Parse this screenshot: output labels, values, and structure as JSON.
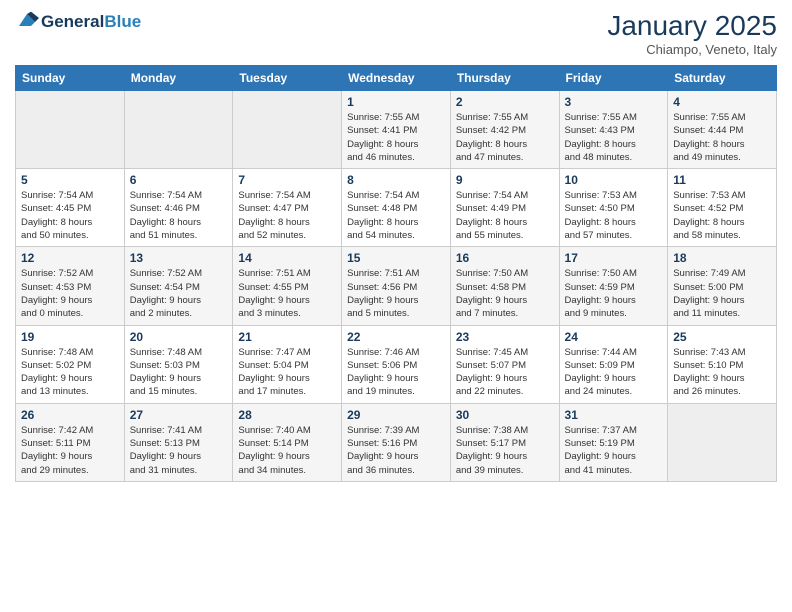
{
  "header": {
    "logo_line1": "General",
    "logo_line2": "Blue",
    "month": "January 2025",
    "location": "Chiampo, Veneto, Italy"
  },
  "weekdays": [
    "Sunday",
    "Monday",
    "Tuesday",
    "Wednesday",
    "Thursday",
    "Friday",
    "Saturday"
  ],
  "weeks": [
    [
      {
        "day": "",
        "info": ""
      },
      {
        "day": "",
        "info": ""
      },
      {
        "day": "",
        "info": ""
      },
      {
        "day": "1",
        "info": "Sunrise: 7:55 AM\nSunset: 4:41 PM\nDaylight: 8 hours\nand 46 minutes."
      },
      {
        "day": "2",
        "info": "Sunrise: 7:55 AM\nSunset: 4:42 PM\nDaylight: 8 hours\nand 47 minutes."
      },
      {
        "day": "3",
        "info": "Sunrise: 7:55 AM\nSunset: 4:43 PM\nDaylight: 8 hours\nand 48 minutes."
      },
      {
        "day": "4",
        "info": "Sunrise: 7:55 AM\nSunset: 4:44 PM\nDaylight: 8 hours\nand 49 minutes."
      }
    ],
    [
      {
        "day": "5",
        "info": "Sunrise: 7:54 AM\nSunset: 4:45 PM\nDaylight: 8 hours\nand 50 minutes."
      },
      {
        "day": "6",
        "info": "Sunrise: 7:54 AM\nSunset: 4:46 PM\nDaylight: 8 hours\nand 51 minutes."
      },
      {
        "day": "7",
        "info": "Sunrise: 7:54 AM\nSunset: 4:47 PM\nDaylight: 8 hours\nand 52 minutes."
      },
      {
        "day": "8",
        "info": "Sunrise: 7:54 AM\nSunset: 4:48 PM\nDaylight: 8 hours\nand 54 minutes."
      },
      {
        "day": "9",
        "info": "Sunrise: 7:54 AM\nSunset: 4:49 PM\nDaylight: 8 hours\nand 55 minutes."
      },
      {
        "day": "10",
        "info": "Sunrise: 7:53 AM\nSunset: 4:50 PM\nDaylight: 8 hours\nand 57 minutes."
      },
      {
        "day": "11",
        "info": "Sunrise: 7:53 AM\nSunset: 4:52 PM\nDaylight: 8 hours\nand 58 minutes."
      }
    ],
    [
      {
        "day": "12",
        "info": "Sunrise: 7:52 AM\nSunset: 4:53 PM\nDaylight: 9 hours\nand 0 minutes."
      },
      {
        "day": "13",
        "info": "Sunrise: 7:52 AM\nSunset: 4:54 PM\nDaylight: 9 hours\nand 2 minutes."
      },
      {
        "day": "14",
        "info": "Sunrise: 7:51 AM\nSunset: 4:55 PM\nDaylight: 9 hours\nand 3 minutes."
      },
      {
        "day": "15",
        "info": "Sunrise: 7:51 AM\nSunset: 4:56 PM\nDaylight: 9 hours\nand 5 minutes."
      },
      {
        "day": "16",
        "info": "Sunrise: 7:50 AM\nSunset: 4:58 PM\nDaylight: 9 hours\nand 7 minutes."
      },
      {
        "day": "17",
        "info": "Sunrise: 7:50 AM\nSunset: 4:59 PM\nDaylight: 9 hours\nand 9 minutes."
      },
      {
        "day": "18",
        "info": "Sunrise: 7:49 AM\nSunset: 5:00 PM\nDaylight: 9 hours\nand 11 minutes."
      }
    ],
    [
      {
        "day": "19",
        "info": "Sunrise: 7:48 AM\nSunset: 5:02 PM\nDaylight: 9 hours\nand 13 minutes."
      },
      {
        "day": "20",
        "info": "Sunrise: 7:48 AM\nSunset: 5:03 PM\nDaylight: 9 hours\nand 15 minutes."
      },
      {
        "day": "21",
        "info": "Sunrise: 7:47 AM\nSunset: 5:04 PM\nDaylight: 9 hours\nand 17 minutes."
      },
      {
        "day": "22",
        "info": "Sunrise: 7:46 AM\nSunset: 5:06 PM\nDaylight: 9 hours\nand 19 minutes."
      },
      {
        "day": "23",
        "info": "Sunrise: 7:45 AM\nSunset: 5:07 PM\nDaylight: 9 hours\nand 22 minutes."
      },
      {
        "day": "24",
        "info": "Sunrise: 7:44 AM\nSunset: 5:09 PM\nDaylight: 9 hours\nand 24 minutes."
      },
      {
        "day": "25",
        "info": "Sunrise: 7:43 AM\nSunset: 5:10 PM\nDaylight: 9 hours\nand 26 minutes."
      }
    ],
    [
      {
        "day": "26",
        "info": "Sunrise: 7:42 AM\nSunset: 5:11 PM\nDaylight: 9 hours\nand 29 minutes."
      },
      {
        "day": "27",
        "info": "Sunrise: 7:41 AM\nSunset: 5:13 PM\nDaylight: 9 hours\nand 31 minutes."
      },
      {
        "day": "28",
        "info": "Sunrise: 7:40 AM\nSunset: 5:14 PM\nDaylight: 9 hours\nand 34 minutes."
      },
      {
        "day": "29",
        "info": "Sunrise: 7:39 AM\nSunset: 5:16 PM\nDaylight: 9 hours\nand 36 minutes."
      },
      {
        "day": "30",
        "info": "Sunrise: 7:38 AM\nSunset: 5:17 PM\nDaylight: 9 hours\nand 39 minutes."
      },
      {
        "day": "31",
        "info": "Sunrise: 7:37 AM\nSunset: 5:19 PM\nDaylight: 9 hours\nand 41 minutes."
      },
      {
        "day": "",
        "info": ""
      }
    ]
  ]
}
